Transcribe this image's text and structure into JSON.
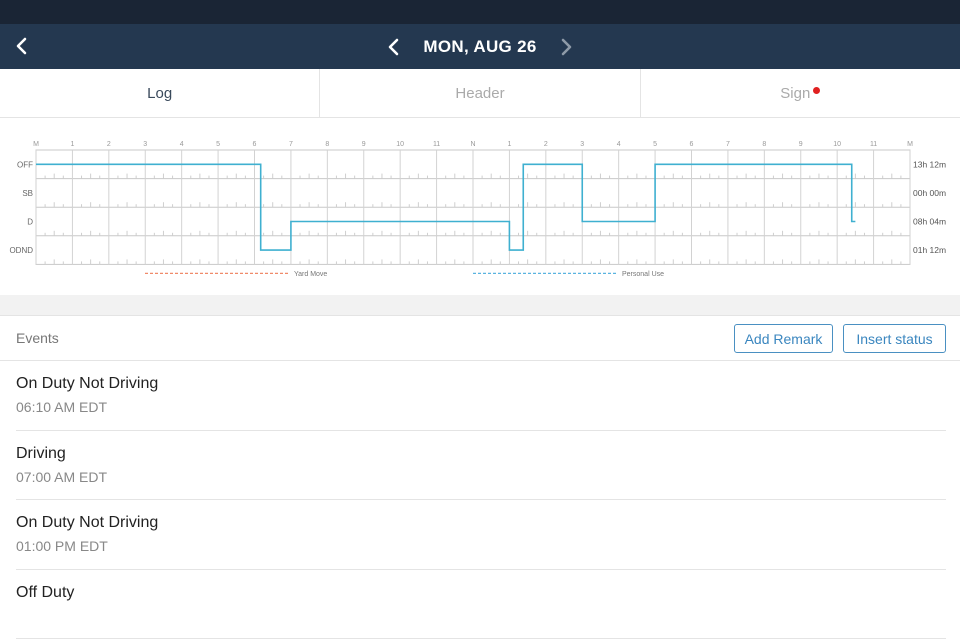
{
  "nav": {
    "date": "MON, AUG 26"
  },
  "tabs": [
    {
      "label": "Log",
      "active": true
    },
    {
      "label": "Header",
      "active": false
    },
    {
      "label": "Sign",
      "active": false,
      "badge": true
    }
  ],
  "colors": {
    "navbar": "#243850",
    "statusbar": "#1a2535",
    "accent": "#3a86bf",
    "log_line": "#3fb0d0",
    "yard_move": "#f08a6a",
    "personal_use": "#5ab4e0",
    "badge": "#e02020"
  },
  "chart_data": {
    "type": "line",
    "hour_labels": [
      "M",
      "1",
      "2",
      "3",
      "4",
      "5",
      "6",
      "7",
      "8",
      "9",
      "10",
      "11",
      "N",
      "1",
      "2",
      "3",
      "4",
      "5",
      "6",
      "7",
      "8",
      "9",
      "10",
      "11",
      "M"
    ],
    "rows": [
      "OFF",
      "SB",
      "D",
      "ODND"
    ],
    "row_totals": [
      "13h 12m",
      "00h 00m",
      "08h 04m",
      "01h 12m"
    ],
    "legend": [
      "Yard Move",
      "Personal Use"
    ],
    "segments": [
      {
        "status": "OFF",
        "start": 0,
        "end": 6.17
      },
      {
        "status": "ODND",
        "start": 6.17,
        "end": 7.0
      },
      {
        "status": "D",
        "start": 7.0,
        "end": 13.0
      },
      {
        "status": "ODND",
        "start": 13.0,
        "end": 13.38
      },
      {
        "status": "OFF",
        "start": 13.38,
        "end": 15.0
      },
      {
        "status": "D",
        "start": 15.0,
        "end": 17.0
      },
      {
        "status": "OFF",
        "start": 17.0,
        "end": 22.4
      },
      {
        "status": "D",
        "start": 22.4,
        "end": 22.5
      }
    ]
  },
  "events": {
    "label": "Events",
    "add_remark": "Add Remark",
    "insert_status": "Insert status",
    "items": [
      {
        "title": "On Duty Not Driving",
        "time": "06:10 AM EDT"
      },
      {
        "title": "Driving",
        "time": "07:00 AM EDT"
      },
      {
        "title": "On Duty Not Driving",
        "time": "01:00 PM EDT"
      },
      {
        "title": "Off Duty",
        "time": ""
      }
    ]
  }
}
